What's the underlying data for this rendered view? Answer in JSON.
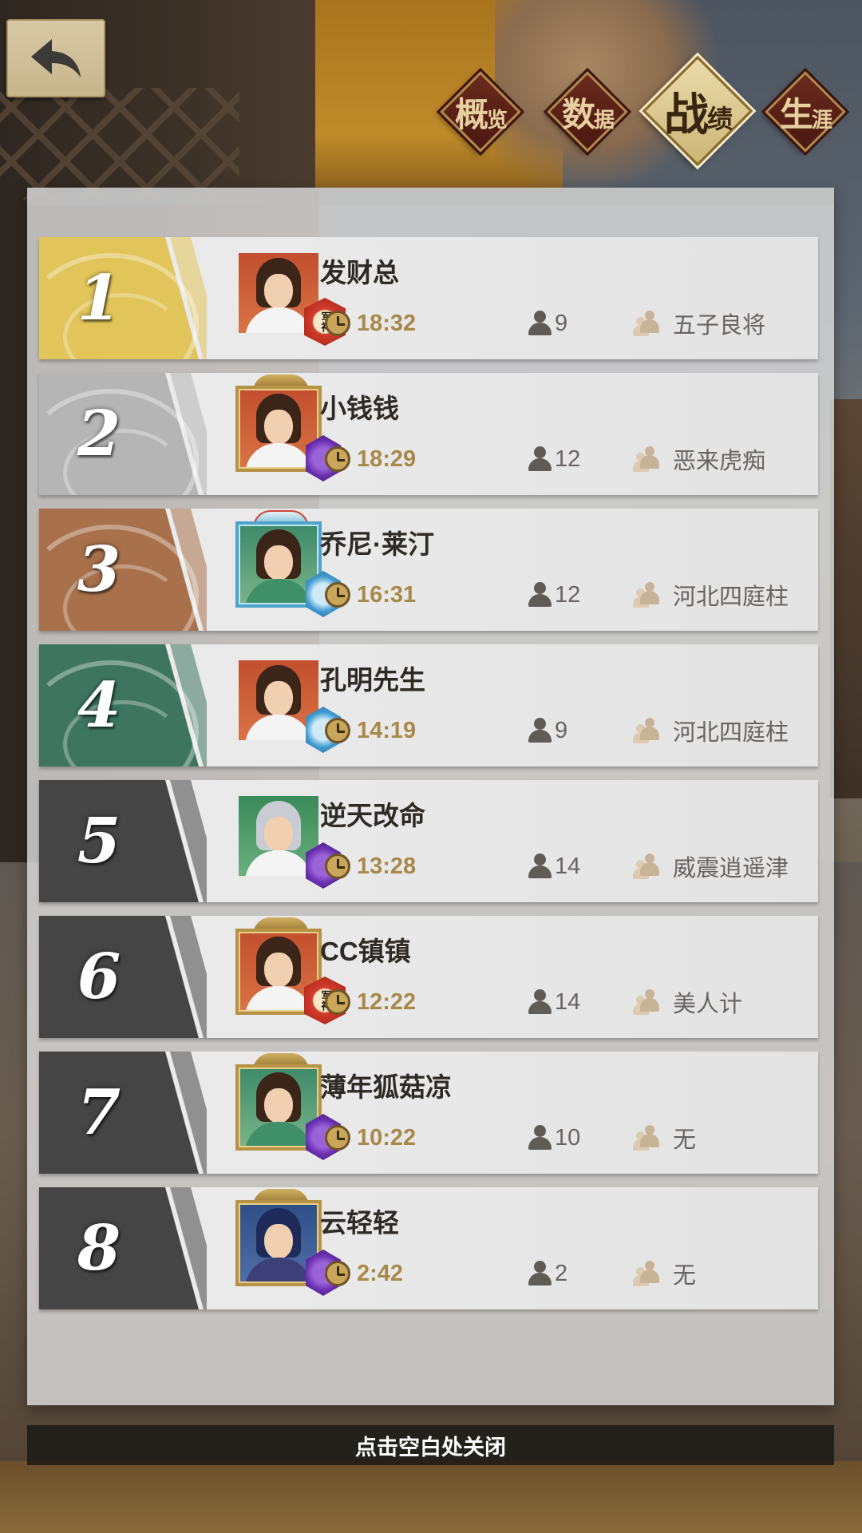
{
  "tabs": [
    {
      "big": "概",
      "small": "览",
      "active": false
    },
    {
      "big": "数",
      "small": "据",
      "active": false
    },
    {
      "big": "战",
      "small": "绩",
      "active": true
    },
    {
      "big": "生",
      "small": "涯",
      "active": false
    }
  ],
  "colors": {
    "rank_gold": "#e1c45a",
    "rank_silver": "#b5b5b5",
    "rank_bronze": "#a8714c",
    "rank_green": "#3e7560",
    "rank_dark": "#454545",
    "time_text": "#a7894a"
  },
  "rankings": [
    {
      "rank": "1",
      "name": "发财总",
      "time": "18:32",
      "count": "9",
      "team": "五子良将",
      "badge_tag": "军神",
      "tag_color": "red",
      "frame": "none"
    },
    {
      "rank": "2",
      "name": "小钱钱",
      "time": "18:29",
      "count": "12",
      "team": "恶来虎痴",
      "badge_tag": "",
      "tag_color": "purple",
      "frame": "gold"
    },
    {
      "rank": "3",
      "name": "乔尼·莱汀",
      "time": "16:31",
      "count": "12",
      "team": "河北四庭柱",
      "badge_tag": "",
      "tag_color": "blue",
      "frame": "blue"
    },
    {
      "rank": "4",
      "name": "孔明先生",
      "time": "14:19",
      "count": "9",
      "team": "河北四庭柱",
      "badge_tag": "",
      "tag_color": "blue",
      "frame": "none"
    },
    {
      "rank": "5",
      "name": "逆天改命",
      "time": "13:28",
      "count": "14",
      "team": "威震逍遥津",
      "badge_tag": "",
      "tag_color": "purple",
      "frame": "none"
    },
    {
      "rank": "6",
      "name": "CC镇镇",
      "time": "12:22",
      "count": "14",
      "team": "美人计",
      "badge_tag": "军神",
      "tag_color": "red",
      "frame": "gold"
    },
    {
      "rank": "7",
      "name": "薄年狐菇凉",
      "time": "10:22",
      "count": "10",
      "team": "无",
      "badge_tag": "",
      "tag_color": "purple",
      "frame": "gold"
    },
    {
      "rank": "8",
      "name": "云轻轻",
      "time": "2:42",
      "count": "2",
      "team": "无",
      "badge_tag": "",
      "tag_color": "purple",
      "frame": "gold"
    }
  ],
  "footer": {
    "close_hint": "点击空白处关闭"
  },
  "icons": {
    "back": "back-arrow-icon",
    "time": "clock-icon",
    "count": "person-icon",
    "team": "team-icon"
  }
}
